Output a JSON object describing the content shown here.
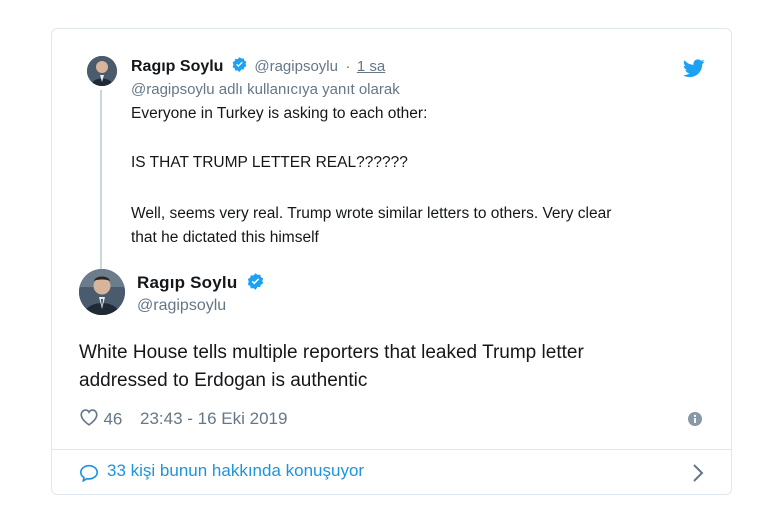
{
  "reply": {
    "name": "Ragıp Soylu",
    "handle": "@ragipsoylu",
    "separator": "·",
    "time": "1 sa",
    "context": "@ragipsoylu adlı kullanıcıya yanıt olarak",
    "line1": "Everyone in Turkey is asking to each other:",
    "line2": "IS THAT TRUMP LETTER REAL??????",
    "line3": "Well, seems very real. Trump wrote similar letters to others. Very clear",
    "line4": "that he dictated this himself"
  },
  "main": {
    "name": "Ragıp Soylu",
    "handle": "@ragipsoylu",
    "text_line1": "White House tells multiple reporters that leaked Trump letter",
    "text_line2": "addressed to Erdogan is authentic",
    "likes": "46",
    "timestamp": "23:43 - 16 Eki 2019"
  },
  "footer": {
    "conversation": "33 kişi bunun hakkında konuşuyor"
  },
  "colors": {
    "twitter_blue": "#1da1f2",
    "link_blue": "#1b95e0",
    "muted": "#657786",
    "border": "#e1e8ed"
  },
  "icons": {
    "brand": "twitter-bird-icon",
    "verified": "verified-badge-icon",
    "like": "heart-icon",
    "info": "info-icon",
    "reply": "speech-bubble-icon",
    "chevron": "chevron-right-icon"
  }
}
